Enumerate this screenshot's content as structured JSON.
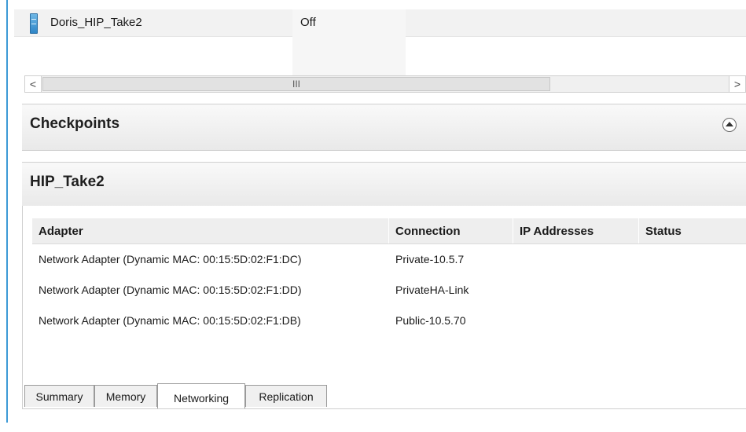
{
  "vm_list": {
    "rows": [
      {
        "name": "Doris_HIP_Take2",
        "state": "Off",
        "icon": "vm-icon"
      }
    ]
  },
  "scrollbar": {
    "left_arrow": "<",
    "right_arrow": ">",
    "thumb_grip": "III"
  },
  "checkpoints": {
    "title": "Checkpoints",
    "collapse_icon": "chevron-up-circle-icon"
  },
  "details": {
    "title": "HIP_Take2",
    "columns": [
      "Adapter",
      "Connection",
      "IP Addresses",
      "Status"
    ],
    "rows": [
      {
        "adapter": "Network Adapter (Dynamic MAC: 00:15:5D:02:F1:DC)",
        "connection": "Private-10.5.7",
        "ip": "",
        "status": ""
      },
      {
        "adapter": "Network Adapter (Dynamic MAC: 00:15:5D:02:F1:DD)",
        "connection": "PrivateHA-Link",
        "ip": "",
        "status": ""
      },
      {
        "adapter": "Network Adapter (Dynamic MAC: 00:15:5D:02:F1:DB)",
        "connection": "Public-10.5.70",
        "ip": "",
        "status": ""
      }
    ]
  },
  "tabs": [
    {
      "label": "Summary",
      "active": false
    },
    {
      "label": "Memory",
      "active": false
    },
    {
      "label": "Networking",
      "active": true
    },
    {
      "label": "Replication",
      "active": false
    }
  ],
  "colors": {
    "accent": "#3c9ad6",
    "header_bg": "#e9e9e9"
  }
}
